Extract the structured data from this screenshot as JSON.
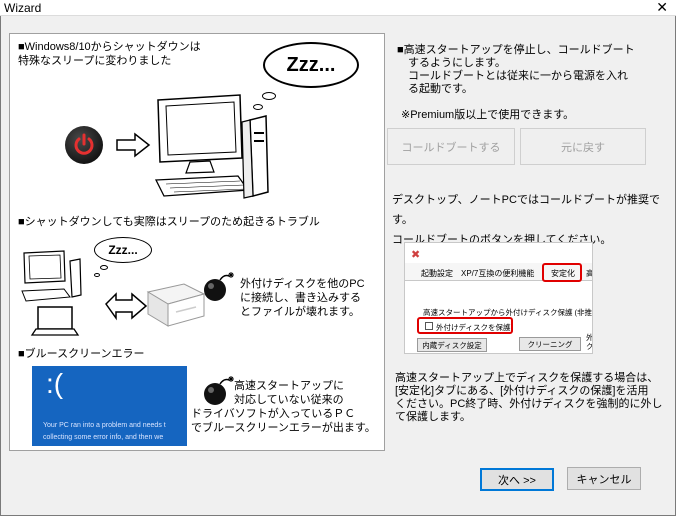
{
  "window": {
    "title": "Wizard",
    "close_glyph": "✕"
  },
  "left": {
    "sec1": "■Windows8/10からシャットダウンは\n特殊なスリープに変わりました",
    "zzz_big": "Zzz...",
    "sec2": "■シャットダウンしても実際はスリープのため起きるトラブル",
    "zzz_small": "Zzz...",
    "disk_text": "外付けディスクを他のPC\nに接続し、書き込みする\nとファイルが壊れます。",
    "sec3": "■ブルースクリーンエラー",
    "bsod_face": ":(",
    "bsod_msg": "Your PC ran into a problem and needs t\ncollecting some error info, and then we",
    "bsod_text1": "高速スタートアップに\n対応していない従来の",
    "bsod_text2": "ドライバソフトが入っているＰＣ\nでブルースクリーンエラーが出ます。"
  },
  "right": {
    "para1": "■高速スタートアップを停止し、コールドブート\n　するようにします。\n　コールドブートとは従来に一から電源を入れ\n　る起動です。",
    "note": "※Premium版以上で使用できます。",
    "cold_boot_button": "コールドブートする",
    "restore_button": "元に戻す",
    "para2": "デスクトップ、ノートPCではコールドブートが推奨です。\nコールドブートのボタンを押してください。",
    "para3": "高速スタートアップ上でディスクを保護する場合は、\n[安定化]タブにある、[外付けディスクの保護]を活用\nください。PC終了時、外付けディスクを強制的に外し\nて保護します。"
  },
  "shot": {
    "tab1": "起動設定",
    "tab2": "XP/7互換の便利機能",
    "tab3": "安定化",
    "tab4": "高",
    "line1": "高速スタートアップから外付けディスク保護 (非推奨機",
    "checkbox_label": "外付けディスクを保護",
    "btn1": "内蔵ディスク設定",
    "btn2": "クリーニング",
    "side": "外\nク"
  },
  "footer": {
    "next_button": "次へ >>",
    "cancel_button": "キャンセル"
  }
}
